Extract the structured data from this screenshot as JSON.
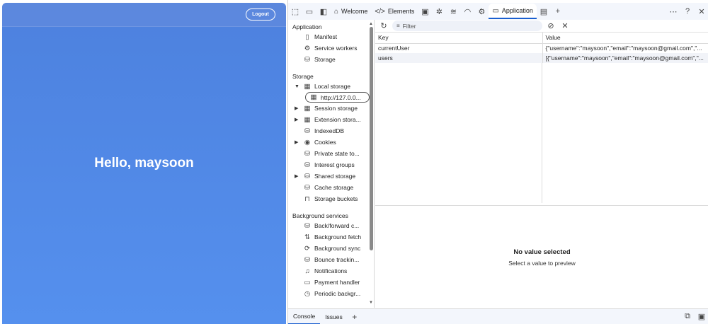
{
  "app": {
    "logout_label": "Logout",
    "greeting": "Hello, maysoon"
  },
  "devtools": {
    "tabs": [
      {
        "label": "Welcome",
        "icon": "home-icon"
      },
      {
        "label": "Elements",
        "icon": "code-icon"
      },
      {
        "label": "Application",
        "icon": "application-icon",
        "active": true
      }
    ],
    "sidebar": {
      "application": {
        "title": "Application",
        "items": [
          "Manifest",
          "Service workers",
          "Storage"
        ]
      },
      "storage": {
        "title": "Storage",
        "items": [
          "Local storage",
          "http://127.0.0...",
          "Session storage",
          "Extension stora...",
          "IndexedDB",
          "Cookies",
          "Private state to...",
          "Interest groups",
          "Shared storage",
          "Cache storage",
          "Storage buckets"
        ]
      },
      "background": {
        "title": "Background services",
        "items": [
          "Back/forward c...",
          "Background fetch",
          "Background sync",
          "Bounce trackin...",
          "Notifications",
          "Payment handler",
          "Periodic backgr..."
        ]
      }
    },
    "filter_placeholder": "Filter",
    "table": {
      "headers": [
        "Key",
        "Value"
      ],
      "rows": [
        {
          "key": "currentUser",
          "value": "{\"username\":\"maysoon\",\"email\":\"maysoon@gmail.com\",\"..."
        },
        {
          "key": "users",
          "value": "[{\"username\":\"maysoon\",\"email\":\"maysoon@gmail.com\",\"..."
        }
      ]
    },
    "preview": {
      "title": "No value selected",
      "subtitle": "Select a value to preview"
    },
    "drawer": {
      "tabs": [
        "Console",
        "Issues"
      ]
    }
  },
  "colors": {
    "app_background": "#4f86e6",
    "active_tab_indicator": "#1a5fd0"
  }
}
